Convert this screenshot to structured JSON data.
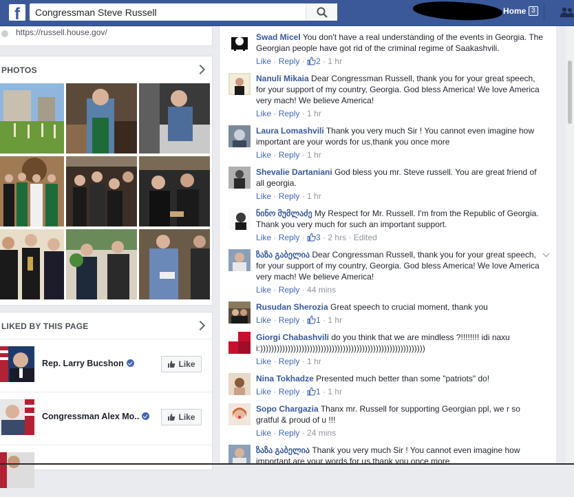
{
  "topbar": {
    "logo": "f",
    "search_value": "Congressman Steve Russell",
    "home_label": "Home",
    "home_count": "3",
    "icons": [
      "facebook-logo",
      "search-icon",
      "friends-icon"
    ]
  },
  "sidebar": {
    "website": "https://russell.house.gov/",
    "photos_heading": "PHOTOS",
    "liked_heading": "LIKED BY THIS PAGE",
    "liked_pages": [
      {
        "name": "Rep. Larry Bucshon",
        "button": "Like"
      },
      {
        "name": "Congressman Alex Mo..",
        "button": "Like"
      }
    ]
  },
  "comments": [
    {
      "name": "Swad Micel",
      "text": "You don't have a real understanding of the events in Georgia. The Georgian people have got rid of the criminal regime of Saakashvili.",
      "like": "Like",
      "reply": "Reply",
      "likes": "2",
      "time": "1 hr"
    },
    {
      "name": "Nanuli Mikaia",
      "text": "Dear Congressman Russell, thank you for your great speech, for your support of my country, Georgia. God bless America! We love America very mach! We believe America!",
      "like": "Like",
      "reply": "Reply",
      "likes": "",
      "time": "1 hr"
    },
    {
      "name": "Laura Lomashvili",
      "text": "Thank you very much Sir ! You cannot even imagine how important are your words for us,thank you once more",
      "like": "Like",
      "reply": "Reply",
      "likes": "",
      "time": "1 hr"
    },
    {
      "name": "Shevalie Dartaniani",
      "text": "God bless you mr. Steve russell. You are great friend of all georgia.",
      "like": "Like",
      "reply": "Reply",
      "likes": "",
      "time": "1 hr"
    },
    {
      "name": "ნინო მუმლაძე",
      "text": "My Respect for Mr. Russell. I'm from the Republic of Georgia. Thank you very much for such an important support.",
      "like": "Like",
      "reply": "Reply",
      "likes": "3",
      "time": "2 hrs",
      "edited": "Edited"
    },
    {
      "name": "ზაზა გაბელია",
      "text": "Dear Congressman Russell, thank you for your great speech, for your support of my country, Georgia. God bless America! We love America very mach! We believe America!",
      "like": "Like",
      "reply": "Reply",
      "likes": "",
      "time": "44 mins"
    },
    {
      "name": "Rusudan Sherozia",
      "text": "Great speech to crucial moment, thank you",
      "like": "Like",
      "reply": "Reply",
      "likes": "1",
      "time": "1 hr"
    },
    {
      "name": "Giorgi Chabashvili",
      "text": "do you think that we are mindless ?!!!!!!!! idi naxui:))))))))))))))))))))))))))))))))))))))))))))))))))))))))))))",
      "like": "Like",
      "reply": "Reply",
      "likes": "",
      "time": "1 hr"
    },
    {
      "name": "Nina Tokhadze",
      "text": "Presented much better than some \"patriots\" do!",
      "like": "Like",
      "reply": "Reply",
      "likes": "1",
      "time": "1 hr"
    },
    {
      "name": "Sopo Chargazia",
      "text": "Thanx mr. Russell for supporting Georgian ppl, we r so gratful & proud of u !!!",
      "like": "Like",
      "reply": "Reply",
      "likes": "",
      "time": "24 mins"
    },
    {
      "name": "ზაზა გაბელია",
      "text": "Thank you very much Sir ! You cannot even imagine how important are your words for us,thank you once more",
      "like": "",
      "reply": "",
      "likes": "",
      "time": ""
    }
  ]
}
